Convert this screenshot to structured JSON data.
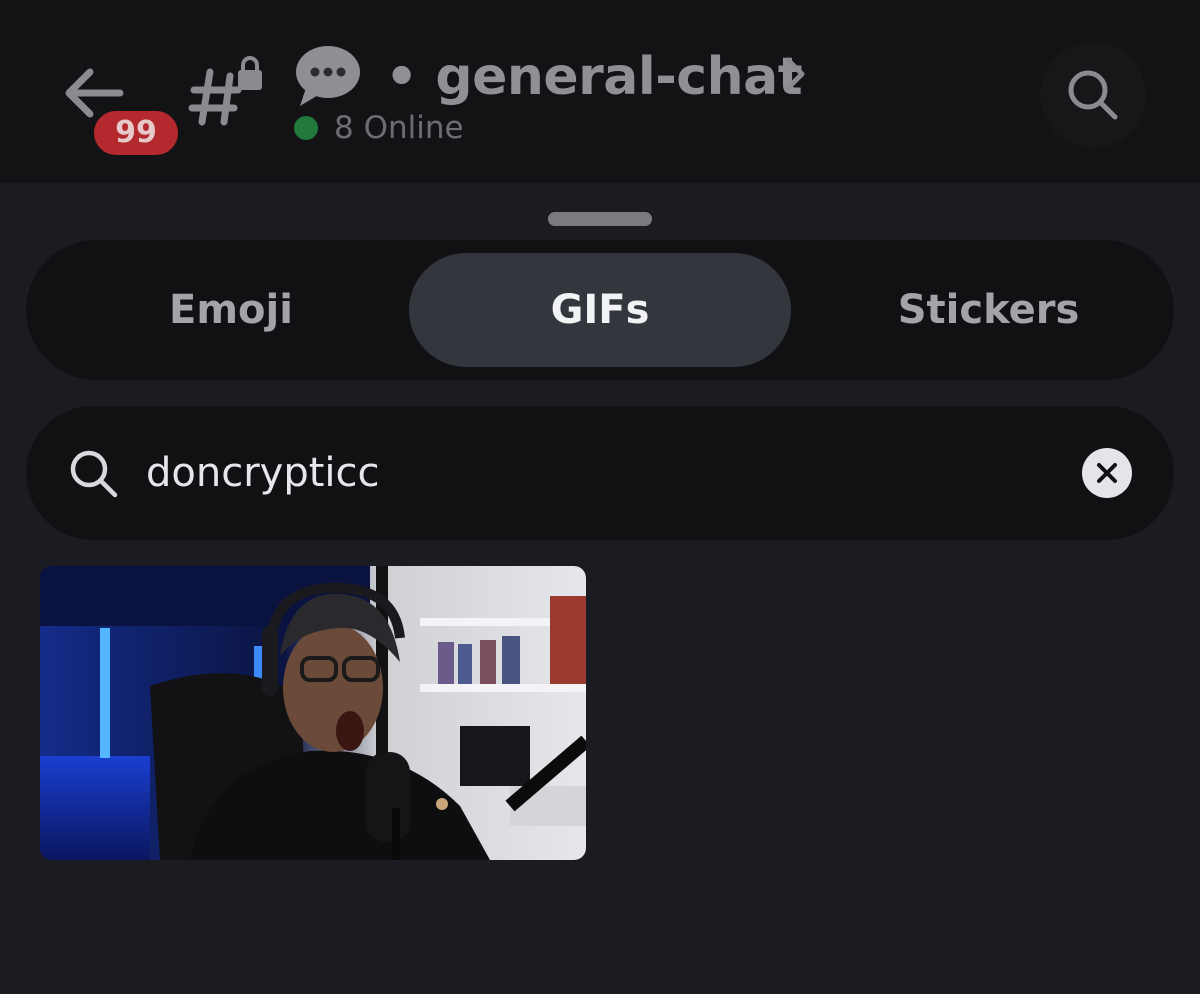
{
  "header": {
    "unread_count": "99",
    "channel_name": "general-chat",
    "separator": "•",
    "online_text": "8 Online",
    "chat_emoji": "speech-balloon-emoji"
  },
  "tabs": [
    {
      "label": "Emoji",
      "active": false
    },
    {
      "label": "GIFs",
      "active": true
    },
    {
      "label": "Stickers",
      "active": false
    }
  ],
  "search": {
    "value": "doncrypticc",
    "placeholder": ""
  },
  "results": [
    {
      "type": "gif",
      "description_icon": "gif-thumbnail"
    }
  ],
  "colors": {
    "background": "#1b1c21",
    "header": "#131316",
    "active_tab": "#34363d",
    "badge": "#b3292e",
    "online": "#23783e"
  }
}
